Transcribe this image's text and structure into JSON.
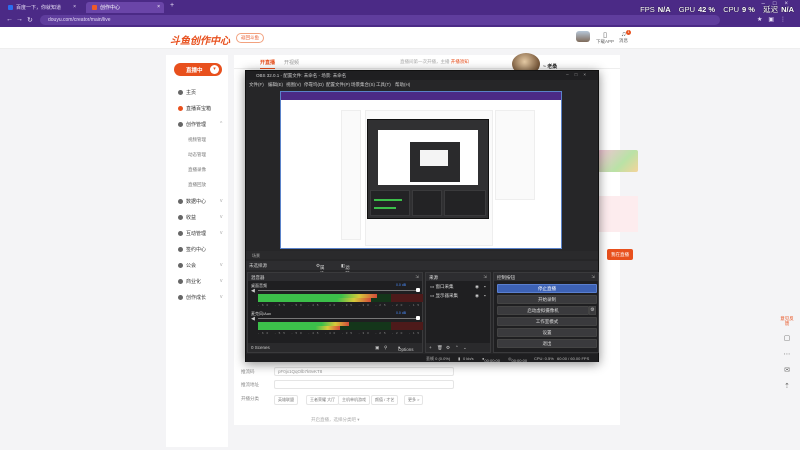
{
  "browser": {
    "tabs": [
      {
        "label": "百度一下，你就知道",
        "active": false
      },
      {
        "label": "创作中心",
        "active": true
      }
    ],
    "url": "douyu.com/creator/main/live",
    "overlay": {
      "fps_label": "FPS",
      "fps_value": "N/A",
      "gpu_label": "GPU",
      "gpu_value": "42 %",
      "cpu_label": "CPU",
      "cpu_value": "9 %",
      "extra_label": "延迟",
      "extra_value": "N/A"
    }
  },
  "site": {
    "logo": "斗鱼创作中心",
    "logo_chip": "返回斗鱼",
    "header_items": [
      {
        "icon": "phone-icon",
        "label": "下载APP"
      },
      {
        "icon": "bell-icon",
        "label": "消息",
        "badge": "1"
      }
    ],
    "sidebar": {
      "live_button": "直播中",
      "items": [
        {
          "label": "主页"
        },
        {
          "label": "直播百宝箱"
        },
        {
          "label": "创作管理"
        },
        {
          "label": "数据中心"
        },
        {
          "label": "收益"
        },
        {
          "label": "互动管理"
        },
        {
          "label": "签约中心"
        },
        {
          "label": "公会"
        },
        {
          "label": "商业化"
        },
        {
          "label": "创作成长"
        }
      ],
      "sub_items": [
        "视频管理",
        "动态管理",
        "直播录像",
        "直播回放"
      ]
    },
    "main": {
      "tabs": [
        "开直播",
        "开视频"
      ],
      "notice_prefix": "直播间第一次开播，主播",
      "notice_link": "开播须知",
      "rows": [
        {
          "label": "推流码",
          "value": "pF0jx1QqOlb7k9vKT8"
        },
        {
          "label": "推流地址",
          "value": ""
        }
      ],
      "categories_label": "开播分类",
      "categories": [
        "英雄联盟",
        "王者荣耀 大厅",
        "主机单机游戏",
        "颜值 / 才艺",
        "更多 >"
      ],
      "more_link": "开启直播，选择分类吧 ▾"
    },
    "right": {
      "streamer_name": "~ 老桑",
      "live_button": "我在直播"
    }
  },
  "obs": {
    "title": "OBS 32.0.1 - 配置文件: 未命名 - 场景: 未命名",
    "menu": [
      "文件(F)",
      "编辑(E)",
      "视图(V)",
      "停靠坞(D)",
      "配置文件(P)",
      "场景集合(S)",
      "工具(T)",
      "帮助(H)"
    ],
    "scene_label": "场景",
    "source_bar": {
      "no_source": "未选择源",
      "settings": "属性",
      "filters": "滤镜"
    },
    "mixer": {
      "title": "混音器",
      "channels": [
        {
          "name": "桌面音频",
          "db": "0.0 dB",
          "level": 0.72
        },
        {
          "name": "麦克风/Aux",
          "db": "0.0 dB",
          "level": 0.55
        }
      ],
      "scale": "-60 -55 -50 -45 -40 -35 -30 -25 -20 -15 -10 -5 0"
    },
    "sources": {
      "title": "来源",
      "items": [
        "窗口采集",
        "显示器采集"
      ]
    },
    "controls": {
      "title": "控制按钮",
      "buttons": [
        "停止直播",
        "开始录制",
        "启动虚拟摄像机",
        "工作室模式",
        "设置",
        "退出"
      ]
    },
    "scene_transitions": {
      "label": "0 Scenes",
      "options": "Options"
    },
    "status": {
      "dropped": "丢帧 0 (0.0%)",
      "bitrate": "0 kb/s",
      "time1": "00:00:00",
      "time2": "00:00:00",
      "cpu": "CPU: 0.5%",
      "fps": "60.00 / 60.00 FPS"
    },
    "colors": {
      "accent": "#3d62b5",
      "meter_green": "#3cbf4a",
      "meter_red": "#d44a3a"
    }
  },
  "accent": "#e8501d",
  "float_bar": [
    "意见反馈",
    "发布",
    "更多",
    "消息",
    "置顶"
  ]
}
